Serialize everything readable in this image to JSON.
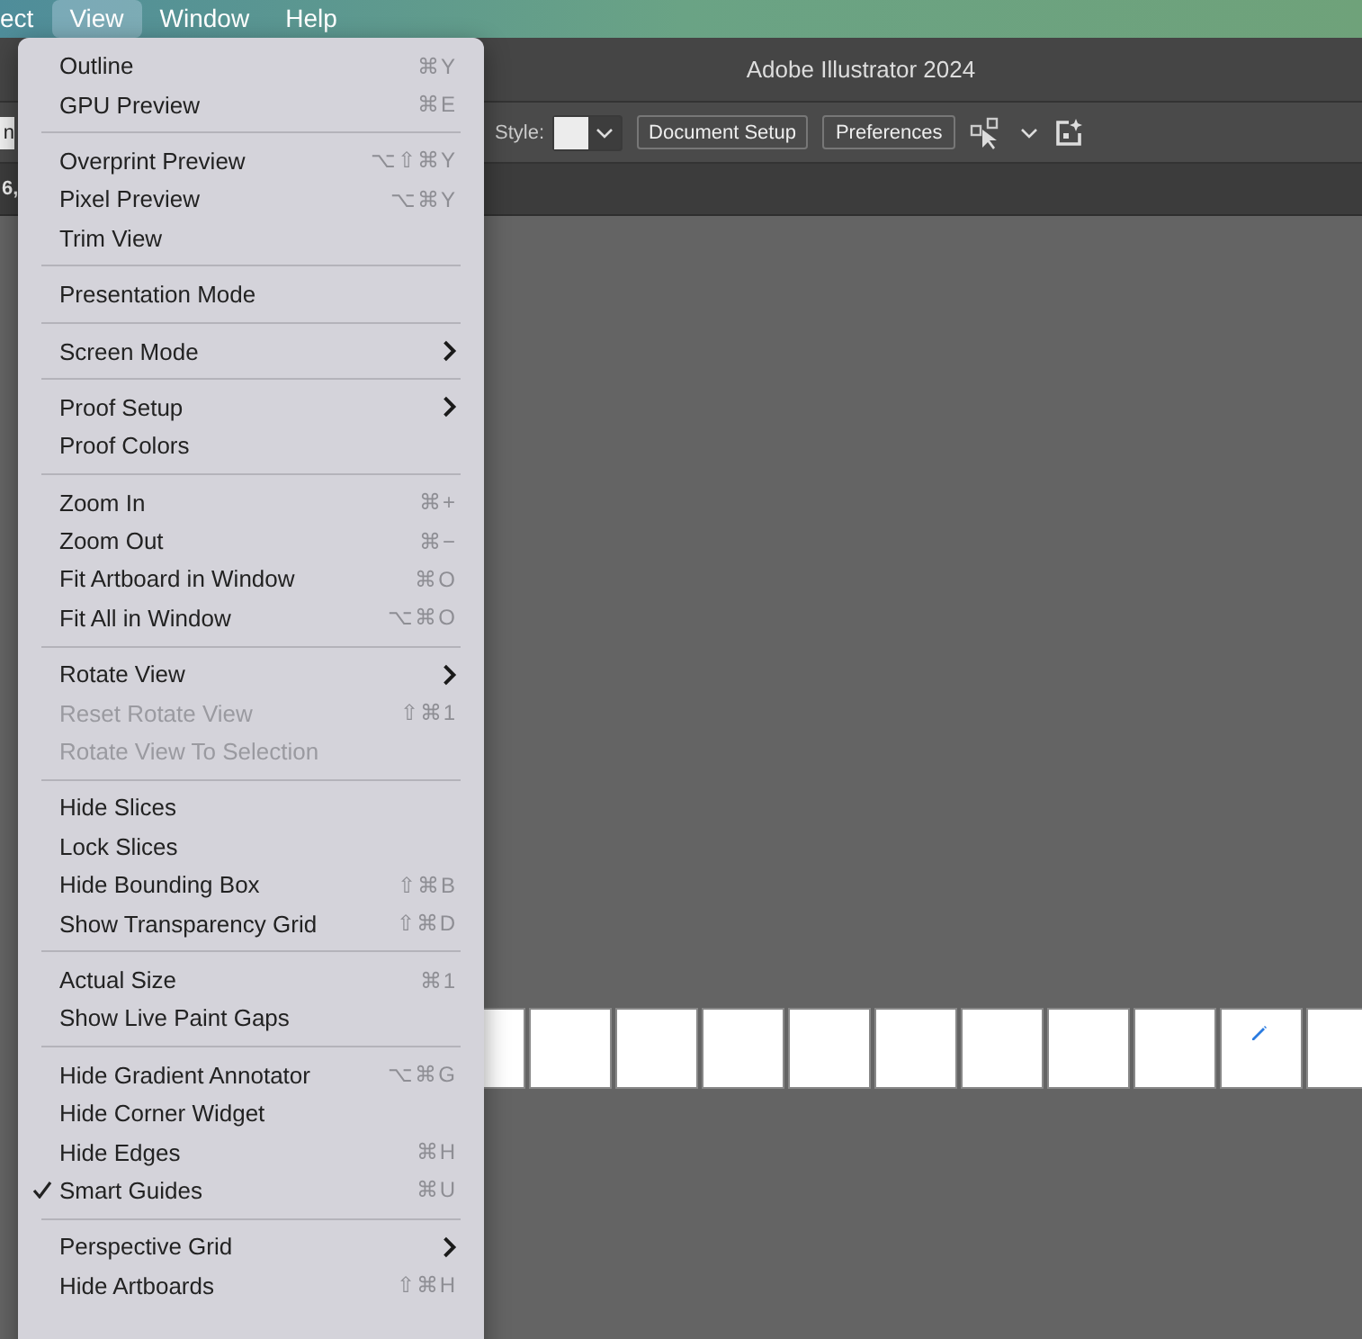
{
  "menu_bar": {
    "items": [
      {
        "label": "ect",
        "selected": false
      },
      {
        "label": "View",
        "selected": true
      },
      {
        "label": "Window",
        "selected": false
      },
      {
        "label": "Help",
        "selected": false
      }
    ]
  },
  "window": {
    "title": "Adobe Illustrator 2024"
  },
  "control_bar": {
    "left_fragment": "n",
    "style_label": "Style:",
    "buttons": [
      "Document Setup",
      "Preferences"
    ]
  },
  "tab_bar": {
    "left_fragment": "6,"
  },
  "artboards": [
    {
      "has_pencil": false
    },
    {
      "has_pencil": false
    },
    {
      "has_pencil": false
    },
    {
      "has_pencil": false
    },
    {
      "has_pencil": false
    },
    {
      "has_pencil": false
    },
    {
      "has_pencil": false
    },
    {
      "has_pencil": false
    },
    {
      "has_pencil": false
    },
    {
      "has_pencil": true
    },
    {
      "has_pencil": false
    }
  ],
  "view_menu": {
    "groups": [
      [
        {
          "label": "Outline",
          "shortcut": "⌘Y",
          "kind": "command",
          "disabled": false,
          "checked": false
        },
        {
          "label": "GPU Preview",
          "shortcut": "⌘E",
          "kind": "command",
          "disabled": false,
          "checked": false
        }
      ],
      [
        {
          "label": "Overprint Preview",
          "shortcut": "⌥⇧⌘Y",
          "kind": "command",
          "disabled": false,
          "checked": false
        },
        {
          "label": "Pixel Preview",
          "shortcut": "⌥⌘Y",
          "kind": "command",
          "disabled": false,
          "checked": false
        },
        {
          "label": "Trim View",
          "kind": "command",
          "disabled": false,
          "checked": false
        }
      ],
      [
        {
          "label": "Presentation Mode",
          "kind": "command",
          "disabled": false,
          "checked": false
        }
      ],
      [
        {
          "label": "Screen Mode",
          "kind": "submenu",
          "disabled": false,
          "checked": false
        }
      ],
      [
        {
          "label": "Proof Setup",
          "kind": "submenu",
          "disabled": false,
          "checked": false
        },
        {
          "label": "Proof Colors",
          "kind": "command",
          "disabled": false,
          "checked": false
        }
      ],
      [
        {
          "label": "Zoom In",
          "shortcut": "⌘+",
          "kind": "command",
          "disabled": false,
          "checked": false
        },
        {
          "label": "Zoom Out",
          "shortcut": "⌘−",
          "kind": "command",
          "disabled": false,
          "checked": false
        },
        {
          "label": "Fit Artboard in Window",
          "shortcut": "⌘O",
          "kind": "command",
          "disabled": false,
          "checked": false
        },
        {
          "label": "Fit All in Window",
          "shortcut": "⌥⌘O",
          "kind": "command",
          "disabled": false,
          "checked": false
        }
      ],
      [
        {
          "label": "Rotate View",
          "kind": "submenu",
          "disabled": false,
          "checked": false
        },
        {
          "label": "Reset Rotate View",
          "shortcut": "⇧⌘1",
          "kind": "command",
          "disabled": true,
          "checked": false
        },
        {
          "label": "Rotate View To Selection",
          "kind": "command",
          "disabled": true,
          "checked": false
        }
      ],
      [
        {
          "label": "Hide Slices",
          "kind": "command",
          "disabled": false,
          "checked": false
        },
        {
          "label": "Lock Slices",
          "kind": "command",
          "disabled": false,
          "checked": false
        },
        {
          "label": "Hide Bounding Box",
          "shortcut": "⇧⌘B",
          "kind": "command",
          "disabled": false,
          "checked": false
        },
        {
          "label": "Show Transparency Grid",
          "shortcut": "⇧⌘D",
          "kind": "command",
          "disabled": false,
          "checked": false
        }
      ],
      [
        {
          "label": "Actual Size",
          "shortcut": "⌘1",
          "kind": "command",
          "disabled": false,
          "checked": false
        },
        {
          "label": "Show Live Paint Gaps",
          "kind": "command",
          "disabled": false,
          "checked": false
        }
      ],
      [
        {
          "label": "Hide Gradient Annotator",
          "shortcut": "⌥⌘G",
          "kind": "command",
          "disabled": false,
          "checked": false
        },
        {
          "label": "Hide Corner Widget",
          "kind": "command",
          "disabled": false,
          "checked": false
        },
        {
          "label": "Hide Edges",
          "shortcut": "⌘H",
          "kind": "command",
          "disabled": false,
          "checked": false
        },
        {
          "label": "Smart Guides",
          "shortcut": "⌘U",
          "kind": "command",
          "disabled": false,
          "checked": true
        }
      ],
      [
        {
          "label": "Perspective Grid",
          "kind": "submenu",
          "disabled": false,
          "checked": false
        },
        {
          "label": "Hide Artboards",
          "shortcut": "⇧⌘H",
          "kind": "command",
          "disabled": false,
          "checked": false
        }
      ]
    ]
  }
}
